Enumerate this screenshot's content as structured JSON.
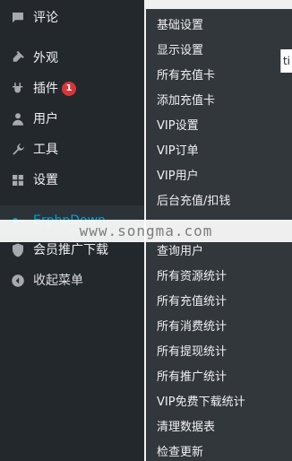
{
  "sidebar": {
    "items": [
      {
        "label": "评论",
        "icon": "comment-icon"
      },
      {
        "label": "外观",
        "icon": "appearance-icon"
      },
      {
        "label": "插件",
        "icon": "plugin-icon",
        "badge": "1"
      },
      {
        "label": "用户",
        "icon": "user-icon"
      },
      {
        "label": "工具",
        "icon": "tool-icon"
      },
      {
        "label": "设置",
        "icon": "settings-icon"
      },
      {
        "label": "ErphpDown",
        "icon": "key-icon"
      },
      {
        "label": "会员推广下载",
        "icon": "shield-icon"
      },
      {
        "label": "收起菜单",
        "icon": "collapse-icon"
      }
    ]
  },
  "submenu": {
    "items": [
      {
        "label": "基础设置"
      },
      {
        "label": "显示设置"
      },
      {
        "label": "所有充值卡"
      },
      {
        "label": "添加充值卡"
      },
      {
        "label": "VIP设置"
      },
      {
        "label": "VIP订单"
      },
      {
        "label": "VIP用户"
      },
      {
        "label": "后台充值/扣钱"
      },
      {
        "label": "查询用户"
      },
      {
        "label": "所有资源统计"
      },
      {
        "label": "所有充值统计"
      },
      {
        "label": "所有消费统计"
      },
      {
        "label": "所有提现统计"
      },
      {
        "label": "所有推广统计"
      },
      {
        "label": "VIP免费下载统计"
      },
      {
        "label": "清理数据表"
      },
      {
        "label": "检查更新"
      }
    ]
  },
  "watermark": {
    "text": "www.songma.com"
  },
  "page": {
    "right_edge_text": "ti"
  },
  "colors": {
    "sidebar_bg": "#23282d",
    "submenu_bg": "#32373c",
    "active_text": "#00a0d2",
    "badge_bg": "#d63638",
    "page_bg": "#f0f0f1"
  }
}
